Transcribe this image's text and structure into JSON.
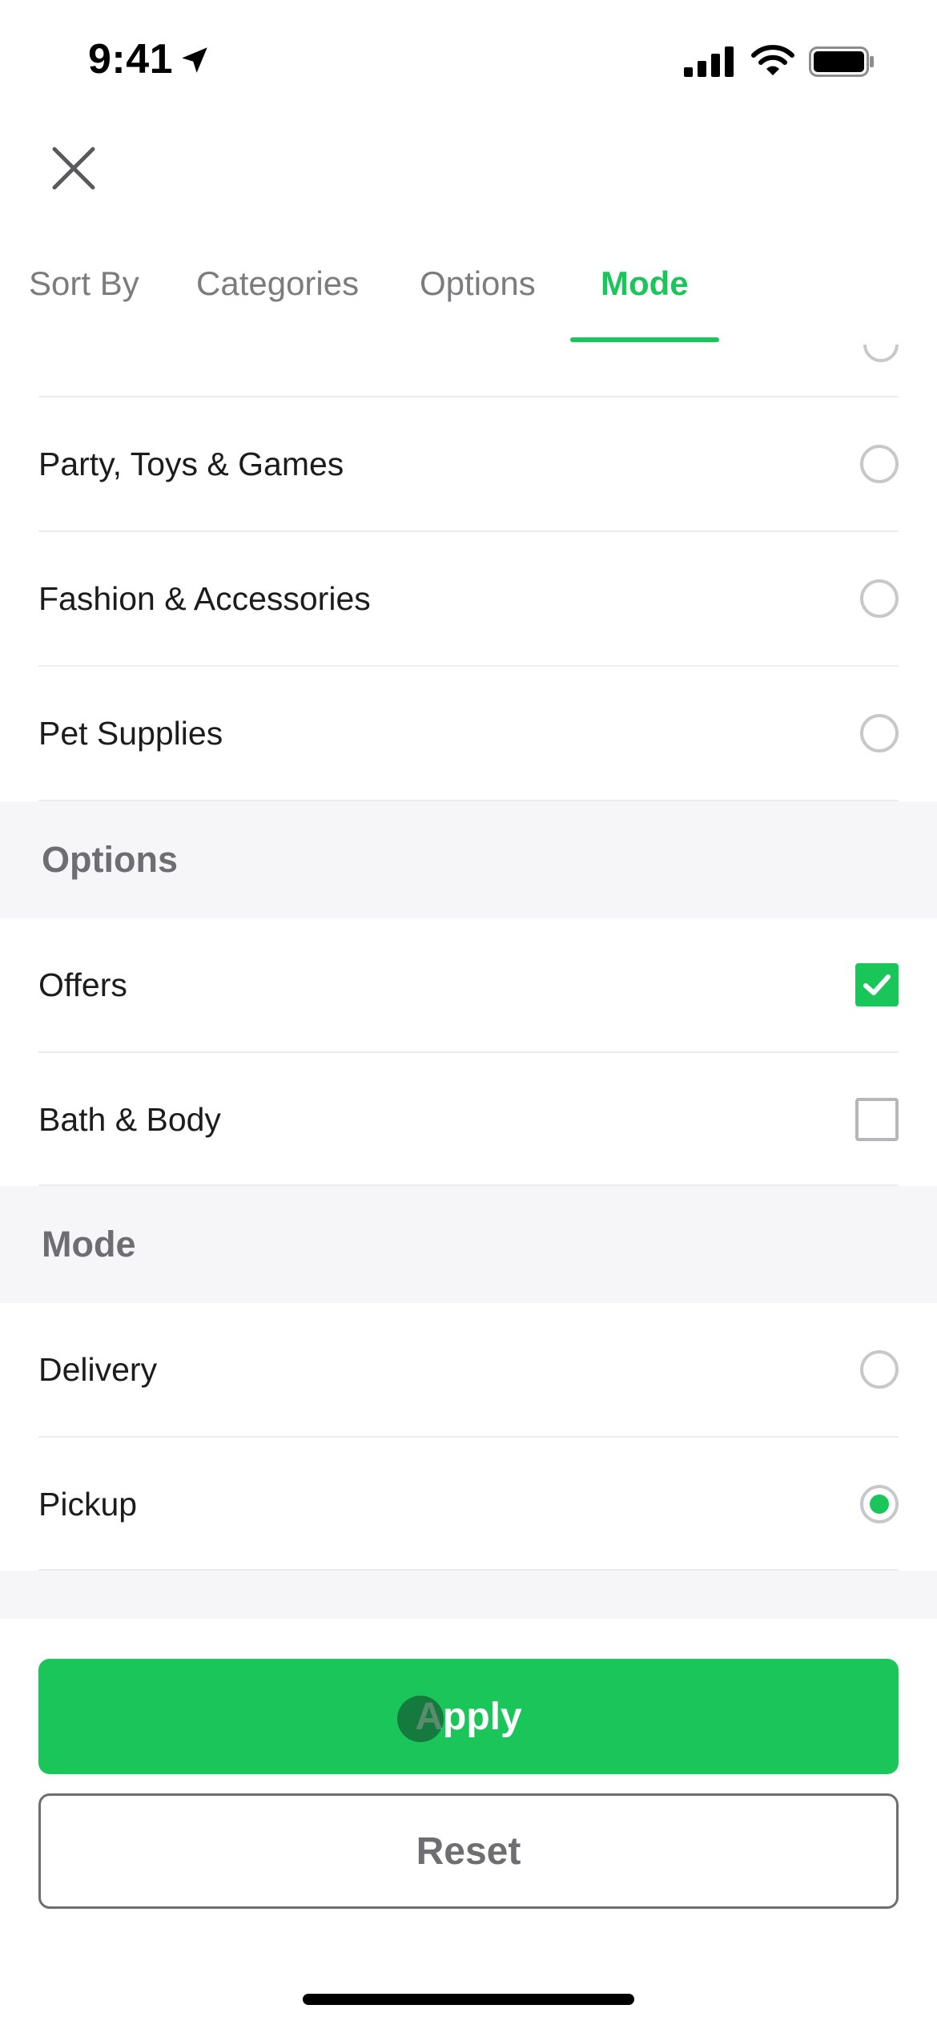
{
  "status_bar": {
    "time": "9:41"
  },
  "tabs": [
    {
      "label": "Sort By"
    },
    {
      "label": "Categories"
    },
    {
      "label": "Options"
    },
    {
      "label": "Mode",
      "active": true
    }
  ],
  "categories": {
    "items": [
      {
        "label": "Party, Toys & Games",
        "selected": false
      },
      {
        "label": "Fashion & Accessories",
        "selected": false
      },
      {
        "label": "Pet Supplies",
        "selected": false
      }
    ]
  },
  "options": {
    "title": "Options",
    "items": [
      {
        "label": "Offers",
        "checked": true
      },
      {
        "label": "Bath & Body",
        "checked": false
      }
    ]
  },
  "mode": {
    "title": "Mode",
    "items": [
      {
        "label": "Delivery",
        "selected": false
      },
      {
        "label": "Pickup",
        "selected": true
      }
    ]
  },
  "footer": {
    "apply_label": "Apply",
    "reset_label": "Reset"
  },
  "colors": {
    "accent": "#1ac55a",
    "muted": "#6d6d72",
    "section_bg": "#f6f6f8"
  },
  "icons": {
    "close": "close-icon",
    "location": "location-arrow-icon",
    "signal": "cellular-signal-icon",
    "wifi": "wifi-icon",
    "battery": "battery-icon",
    "check": "checkmark-icon"
  }
}
